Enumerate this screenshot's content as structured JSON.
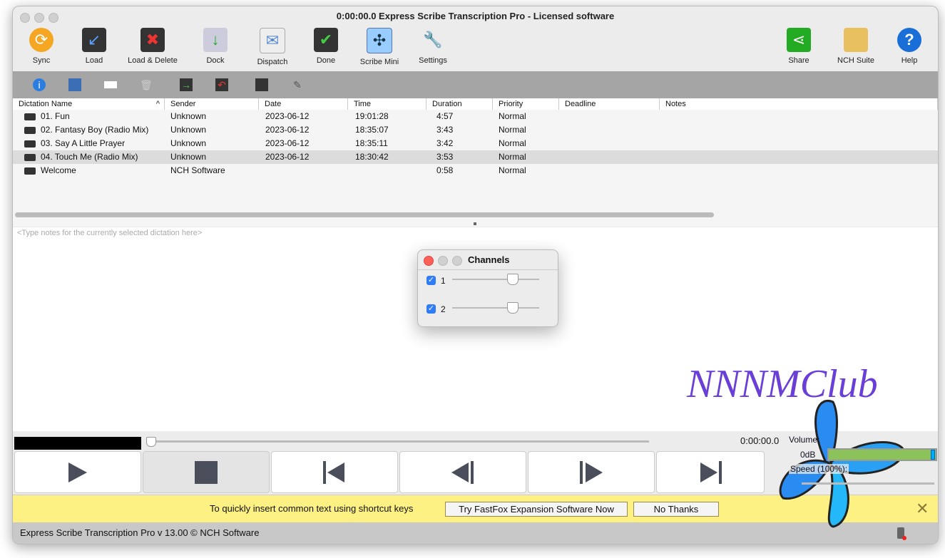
{
  "window": {
    "title": "0:00:00.0 Express Scribe Transcription Pro - Licensed software"
  },
  "toolbar": [
    {
      "label": "Sync",
      "icon": "sync-icon"
    },
    {
      "label": "Load",
      "icon": "load-icon"
    },
    {
      "label": "Load & Delete",
      "icon": "load-delete-icon"
    },
    {
      "label": "Dock",
      "icon": "dock-icon"
    },
    {
      "label": "Dispatch",
      "icon": "dispatch-icon"
    },
    {
      "label": "Done",
      "icon": "done-icon"
    },
    {
      "label": "Scribe Mini",
      "icon": "scribe-mini-icon"
    },
    {
      "label": "Settings",
      "icon": "settings-icon"
    },
    {
      "label": "Share",
      "icon": "share-icon"
    },
    {
      "label": "NCH Suite",
      "icon": "nch-suite-icon"
    },
    {
      "label": "Help",
      "icon": "help-icon"
    }
  ],
  "columns": [
    "Dictation Name",
    "Sender",
    "Date",
    "Time",
    "Duration",
    "Priority",
    "Deadline",
    "Notes"
  ],
  "rows": [
    [
      "01. Fun",
      "Unknown",
      "2023-06-12",
      "19:01:28",
      "4:57",
      "Normal"
    ],
    [
      "02. Fantasy Boy (Radio Mix)",
      "Unknown",
      "2023-06-12",
      "18:35:07",
      "3:43",
      "Normal"
    ],
    [
      "03. Say A Little Prayer",
      "Unknown",
      "2023-06-12",
      "18:35:11",
      "3:42",
      "Normal"
    ],
    [
      "04. Touch Me (Radio Mix)",
      "Unknown",
      "2023-06-12",
      "18:30:42",
      "3:53",
      "Normal"
    ],
    [
      "Welcome",
      "NCH Software",
      "",
      "",
      "0:58",
      "Normal"
    ]
  ],
  "notes_placeholder": "<Type notes for the currently selected dictation here>",
  "channels": {
    "title": "Channels",
    "items": [
      {
        "label": "1",
        "checked": true,
        "level": 0.7
      },
      {
        "label": "2",
        "checked": true,
        "level": 0.7
      }
    ]
  },
  "watermark": "NNNMClub",
  "transport": {
    "time": "0:00:00.0",
    "volume_label": "Volume:",
    "volume_value": "0dB",
    "speed_label": "Speed (100%):"
  },
  "banner": {
    "text": "To quickly insert common text using shortcut keys",
    "try_button": "Try FastFox Expansion Software Now",
    "no_button": "No Thanks"
  },
  "status": "Express Scribe Transcription Pro v 13.00 © NCH Software"
}
